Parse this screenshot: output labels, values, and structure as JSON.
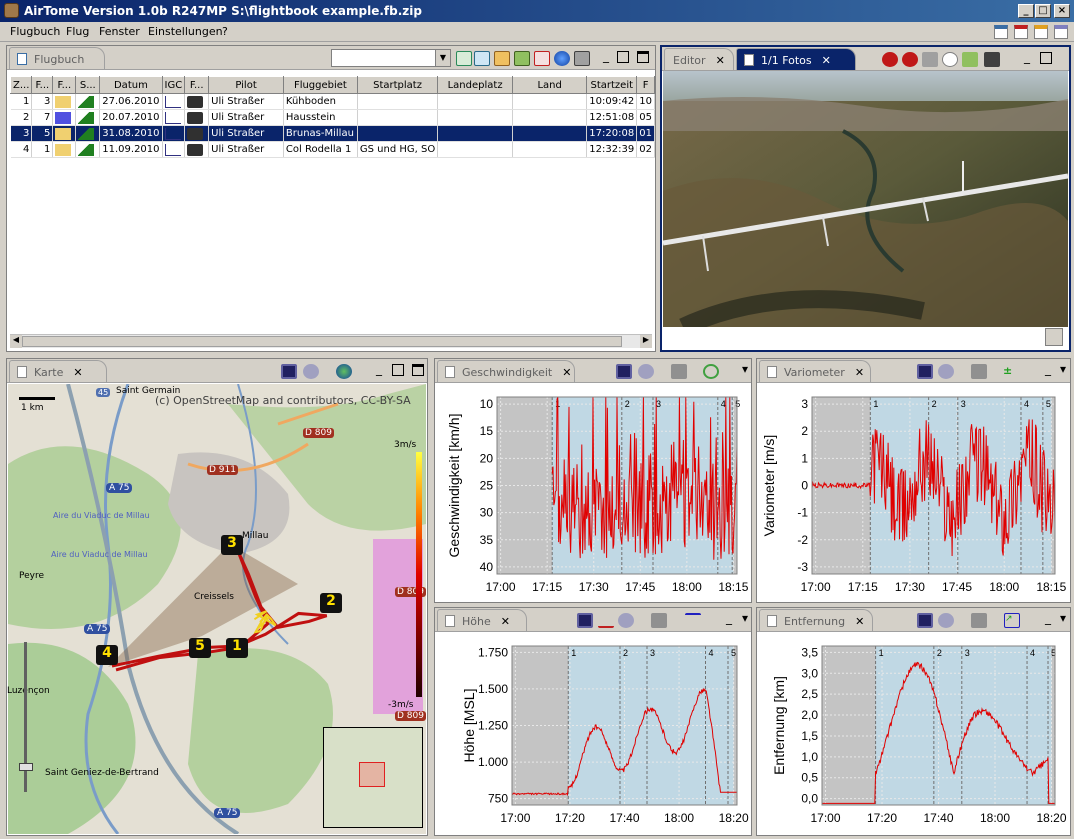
{
  "window": {
    "title": "AirTome Version 1.0b R247MP   S:\\flightbook example.fb.zip"
  },
  "menu": [
    "Flugbuch",
    "Flug",
    "Fenster",
    "Einstellungen",
    "?"
  ],
  "flugbuch": {
    "tab": "Flugbuch",
    "columns": [
      "Z...",
      "F...",
      "F...",
      "S...",
      "Datum",
      "IGC",
      "F...",
      "Pilot",
      "Fluggebiet",
      "Startplatz",
      "Landeplatz",
      "Land",
      "Startzeit",
      "F"
    ],
    "rows": [
      {
        "z": "1",
        "f": "3",
        "datum": "27.06.2010",
        "pilot": "Uli Straßer",
        "gebiet": "Kühboden",
        "start": "",
        "lande": "",
        "land": "",
        "zeit": "10:09:42",
        "x": "10"
      },
      {
        "z": "2",
        "f": "7",
        "datum": "20.07.2010",
        "pilot": "Uli Straßer",
        "gebiet": "Hausstein",
        "start": "",
        "lande": "",
        "land": "",
        "zeit": "12:51:08",
        "x": "05"
      },
      {
        "z": "3",
        "f": "5",
        "datum": "31.08.2010",
        "pilot": "Uli Straßer",
        "gebiet": "Brunas-Millau",
        "start": "",
        "lande": "",
        "land": "",
        "zeit": "17:20:08",
        "x": "01"
      },
      {
        "z": "4",
        "f": "1",
        "datum": "11.09.2010",
        "pilot": "Uli Straßer",
        "gebiet": "Col Rodella  1",
        "start": "GS und HG, SO",
        "lande": "",
        "land": "",
        "zeit": "12:32:39",
        "x": "02"
      }
    ],
    "selected_row": 2
  },
  "photos": {
    "tab_editor": "Editor",
    "tab_fotos": "1/1 Fotos"
  },
  "map": {
    "tab": "Karte",
    "attribution": "(c) OpenStreetMap and contributors, CC-BY-SA",
    "scale": "1 km",
    "labels": [
      "Saint Germain",
      "Millau",
      "Creissels",
      "Peyre",
      "Luzençon",
      "Saint Geniez-de-Bertrand",
      "Aire du Viaduc de Millau",
      "Aire du Viaduc de Millau",
      "D 809",
      "D 911",
      "A 75",
      "A 75",
      "A 75",
      "D 809",
      "D 809",
      "45"
    ],
    "waypoints": [
      "1",
      "2",
      "3",
      "4",
      "5"
    ],
    "legend_top": "3m/s",
    "legend_bottom": "-3m/s"
  },
  "chart_data": [
    {
      "tab": "Geschwindigkeit",
      "type": "line",
      "ylabel": "Geschwindigkeit [km/h]",
      "x_ticks": [
        "17:00",
        "17:15",
        "17:30",
        "17:45",
        "18:00",
        "18:15"
      ],
      "y_ticks": [
        "10",
        "15",
        "20",
        "25",
        "30",
        "35",
        "40"
      ],
      "ylim": [
        7,
        45
      ],
      "markers": [
        "1",
        "2",
        "3",
        "4",
        "5"
      ]
    },
    {
      "tab": "Variometer",
      "type": "line",
      "ylabel": "Variometer [m/s]",
      "x_ticks": [
        "17:00",
        "17:15",
        "17:30",
        "17:45",
        "18:00",
        "18:15"
      ],
      "y_ticks": [
        "3",
        "2",
        "1",
        "0",
        "-1",
        "-2",
        "-3"
      ],
      "ylim": [
        -3.3,
        3.3
      ],
      "markers": [
        "1",
        "2",
        "3",
        "4",
        "5"
      ]
    },
    {
      "tab": "Höhe",
      "type": "line",
      "ylabel": "Höhe [MSL]",
      "x_ticks": [
        "17:00",
        "17:20",
        "17:40",
        "18:00",
        "18:20"
      ],
      "y_ticks": [
        "1.750",
        "1.500",
        "1.250",
        "1.000",
        "750"
      ],
      "ylim": [
        650,
        1780
      ],
      "markers": [
        "1",
        "2",
        "3",
        "4",
        "5"
      ]
    },
    {
      "tab": "Entfernung",
      "type": "line",
      "ylabel": "Entfernung [km]",
      "x_ticks": [
        "17:00",
        "17:20",
        "17:40",
        "18:00",
        "18:20"
      ],
      "y_ticks": [
        "3,5",
        "3,0",
        "2,5",
        "2,0",
        "1,5",
        "1,0",
        "0,5",
        "0,0"
      ],
      "ylim": [
        0,
        3.6
      ],
      "markers": [
        "1",
        "2",
        "3",
        "4",
        "5"
      ]
    }
  ]
}
